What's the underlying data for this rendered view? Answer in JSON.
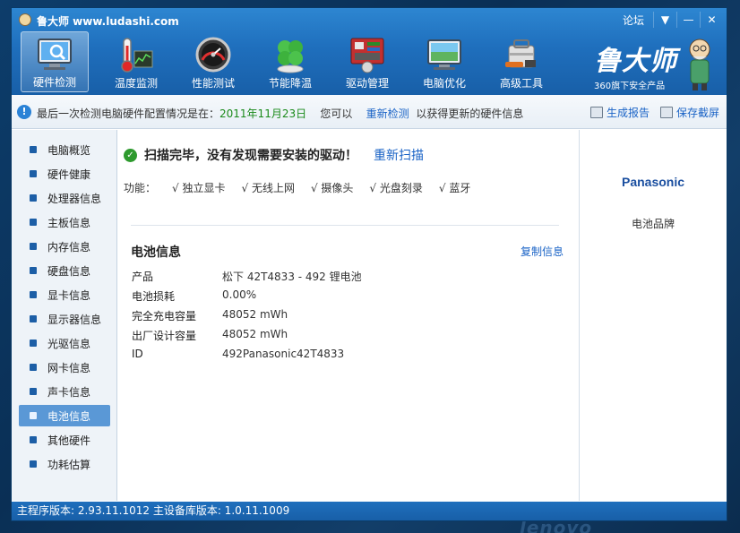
{
  "window": {
    "title": "鲁大师 www.ludashi.com",
    "forum": "论坛",
    "menu_glyph": "▼",
    "min_glyph": "—",
    "close_glyph": "✕"
  },
  "toolbar": {
    "items": [
      {
        "label": "硬件检测",
        "icon": "monitor-magnifier-icon"
      },
      {
        "label": "温度监测",
        "icon": "thermometer-icon"
      },
      {
        "label": "性能测试",
        "icon": "gauge-icon"
      },
      {
        "label": "节能降温",
        "icon": "clover-icon"
      },
      {
        "label": "驱动管理",
        "icon": "circuit-board-icon"
      },
      {
        "label": "电脑优化",
        "icon": "monitor-tune-icon"
      },
      {
        "label": "高级工具",
        "icon": "toolbox-icon"
      }
    ],
    "brand": "鲁大师",
    "brand_sub": "360旗下安全产品"
  },
  "infobar": {
    "prefix": "最后一次检测电脑硬件配置情况是在：",
    "date": "2011年11月23日",
    "middle": "您可以",
    "rescan": "重新检测",
    "suffix": "以获得更新的硬件信息",
    "report": "生成报告",
    "screenshot": "保存截屏"
  },
  "sidebar": {
    "items": [
      "电脑概览",
      "硬件健康",
      "处理器信息",
      "主板信息",
      "内存信息",
      "硬盘信息",
      "显卡信息",
      "显示器信息",
      "光驱信息",
      "网卡信息",
      "声卡信息",
      "电池信息",
      "其他硬件",
      "功耗估算"
    ],
    "active": "电池信息"
  },
  "main": {
    "scan_status": "扫描完毕，没有发现需要安装的驱动！",
    "rescan": "重新扫描",
    "func_label": "功能：",
    "functions": [
      "√ 独立显卡",
      "√ 无线上网",
      "√ 摄像头",
      "√ 光盘刻录",
      "√ 蓝牙"
    ],
    "section_title": "电池信息",
    "copy": "复制信息",
    "rows": [
      {
        "key": "产品",
        "value": "松下 42T4833 -   492 锂电池"
      },
      {
        "key": "电池损耗",
        "value": "0.00%"
      },
      {
        "key": "完全充电容量",
        "value": "48052 mWh"
      },
      {
        "key": "出厂设计容量",
        "value": "48052 mWh"
      },
      {
        "key": "ID",
        "value": "492Panasonic42T4833"
      }
    ]
  },
  "right": {
    "brand": "Panasonic",
    "label": "电池品牌"
  },
  "status": {
    "text": "主程序版本: 2.93.11.1012  主设备库版本: 1.0.11.1009"
  },
  "desktop": {
    "brand": "lenovo"
  },
  "colors": {
    "header": "#1f6fbd",
    "link": "#1a63c6",
    "date": "#1a8a1a",
    "active_item": "#5a98d6"
  }
}
